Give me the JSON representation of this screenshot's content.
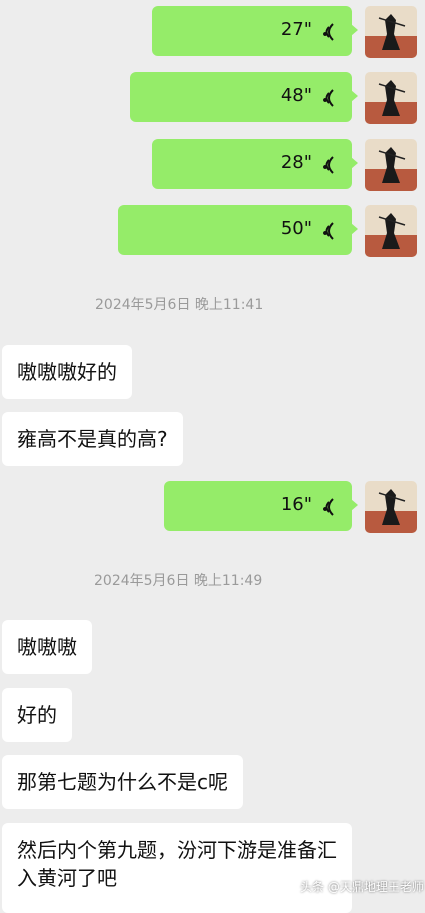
{
  "voice_messages": [
    {
      "duration": "27\""
    },
    {
      "duration": "48\""
    },
    {
      "duration": "28\""
    },
    {
      "duration": "50\""
    },
    {
      "duration": "16\""
    }
  ],
  "timestamps": [
    "2024年5月6日 晚上11:41",
    "2024年5月6日 晚上11:49"
  ],
  "text_messages": [
    "嗷嗷嗷好的",
    "雍高不是真的高?",
    "嗷嗷嗷",
    "好的",
    "那第七题为什么不是c呢",
    "然后内个第九题，汾河下游是准备汇入黄河了吧"
  ],
  "watermark": "头条 @天鼎地理王老师",
  "colors": {
    "background": "#ededed",
    "sent_bubble": "#95ec69",
    "received_bubble": "#ffffff",
    "timestamp_text": "#9a9a9a"
  },
  "icons": [
    "voice-wave-icon",
    "avatar-icon"
  ]
}
